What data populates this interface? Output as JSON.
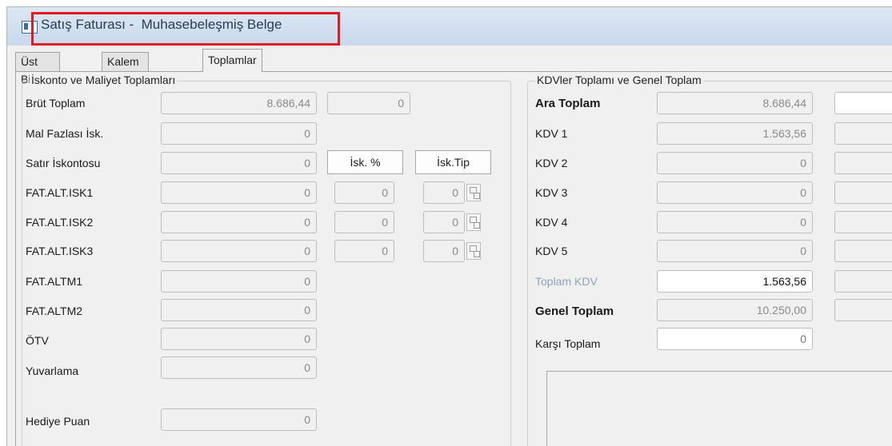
{
  "window": {
    "title": "Satış Faturası -  Muhasebeleşmiş Belge"
  },
  "tabs": [
    {
      "label": "Üst Bilgiler"
    },
    {
      "label": "Kalem Bilgileri"
    },
    {
      "label": "Toplamlar"
    }
  ],
  "left": {
    "group_title": "İskonto ve Maliyet Toplamları",
    "isk_pct_header": "İsk. %",
    "isk_tip_header": "İsk.Tip",
    "rows": {
      "brut": {
        "label": "Brüt Toplam",
        "value": "8.686,44",
        "extra": "0"
      },
      "mal_fazlasi": {
        "label": "Mal Fazlası İsk.",
        "value": "0"
      },
      "satir_isk": {
        "label": "Satır İskontosu",
        "value": "0"
      },
      "isk1": {
        "label": "FAT.ALT.ISK1",
        "value": "0",
        "pct": "0",
        "tip": "0"
      },
      "isk2": {
        "label": "FAT.ALT.ISK2",
        "value": "0",
        "pct": "0",
        "tip": "0"
      },
      "isk3": {
        "label": "FAT.ALT.ISK3",
        "value": "0",
        "pct": "0",
        "tip": "0"
      },
      "altm1": {
        "label": "FAT.ALTM1",
        "value": "0"
      },
      "altm2": {
        "label": "FAT.ALTM2",
        "value": "0"
      },
      "otv": {
        "label": "ÖTV",
        "value": "0"
      },
      "yuvarlama": {
        "label": "Yuvarlama",
        "value": "0"
      },
      "hediye": {
        "label": "Hediye Puan",
        "value": "0"
      }
    }
  },
  "right": {
    "group_title": "KDVler Toplamı ve Genel Toplam",
    "rows": {
      "ara": {
        "label": "Ara Toplam",
        "value": "8.686,44"
      },
      "kdv1": {
        "label": "KDV 1",
        "value": "1.563,56"
      },
      "kdv2": {
        "label": "KDV 2",
        "value": "0"
      },
      "kdv3": {
        "label": "KDV 3",
        "value": "0"
      },
      "kdv4": {
        "label": "KDV 4",
        "value": "0"
      },
      "kdv5": {
        "label": "KDV 5",
        "value": "0"
      },
      "toplam_kdv": {
        "label": "Toplam KDV",
        "value": "1.563,56"
      },
      "genel": {
        "label": "Genel Toplam",
        "value": "10.250,00"
      },
      "karsi": {
        "label": "Karşı Toplam",
        "value": "0"
      }
    }
  },
  "colors": {
    "highlight": "#e01b24",
    "window_bg": "#f0f0f0",
    "disabled_text": "#8a8a8a"
  }
}
